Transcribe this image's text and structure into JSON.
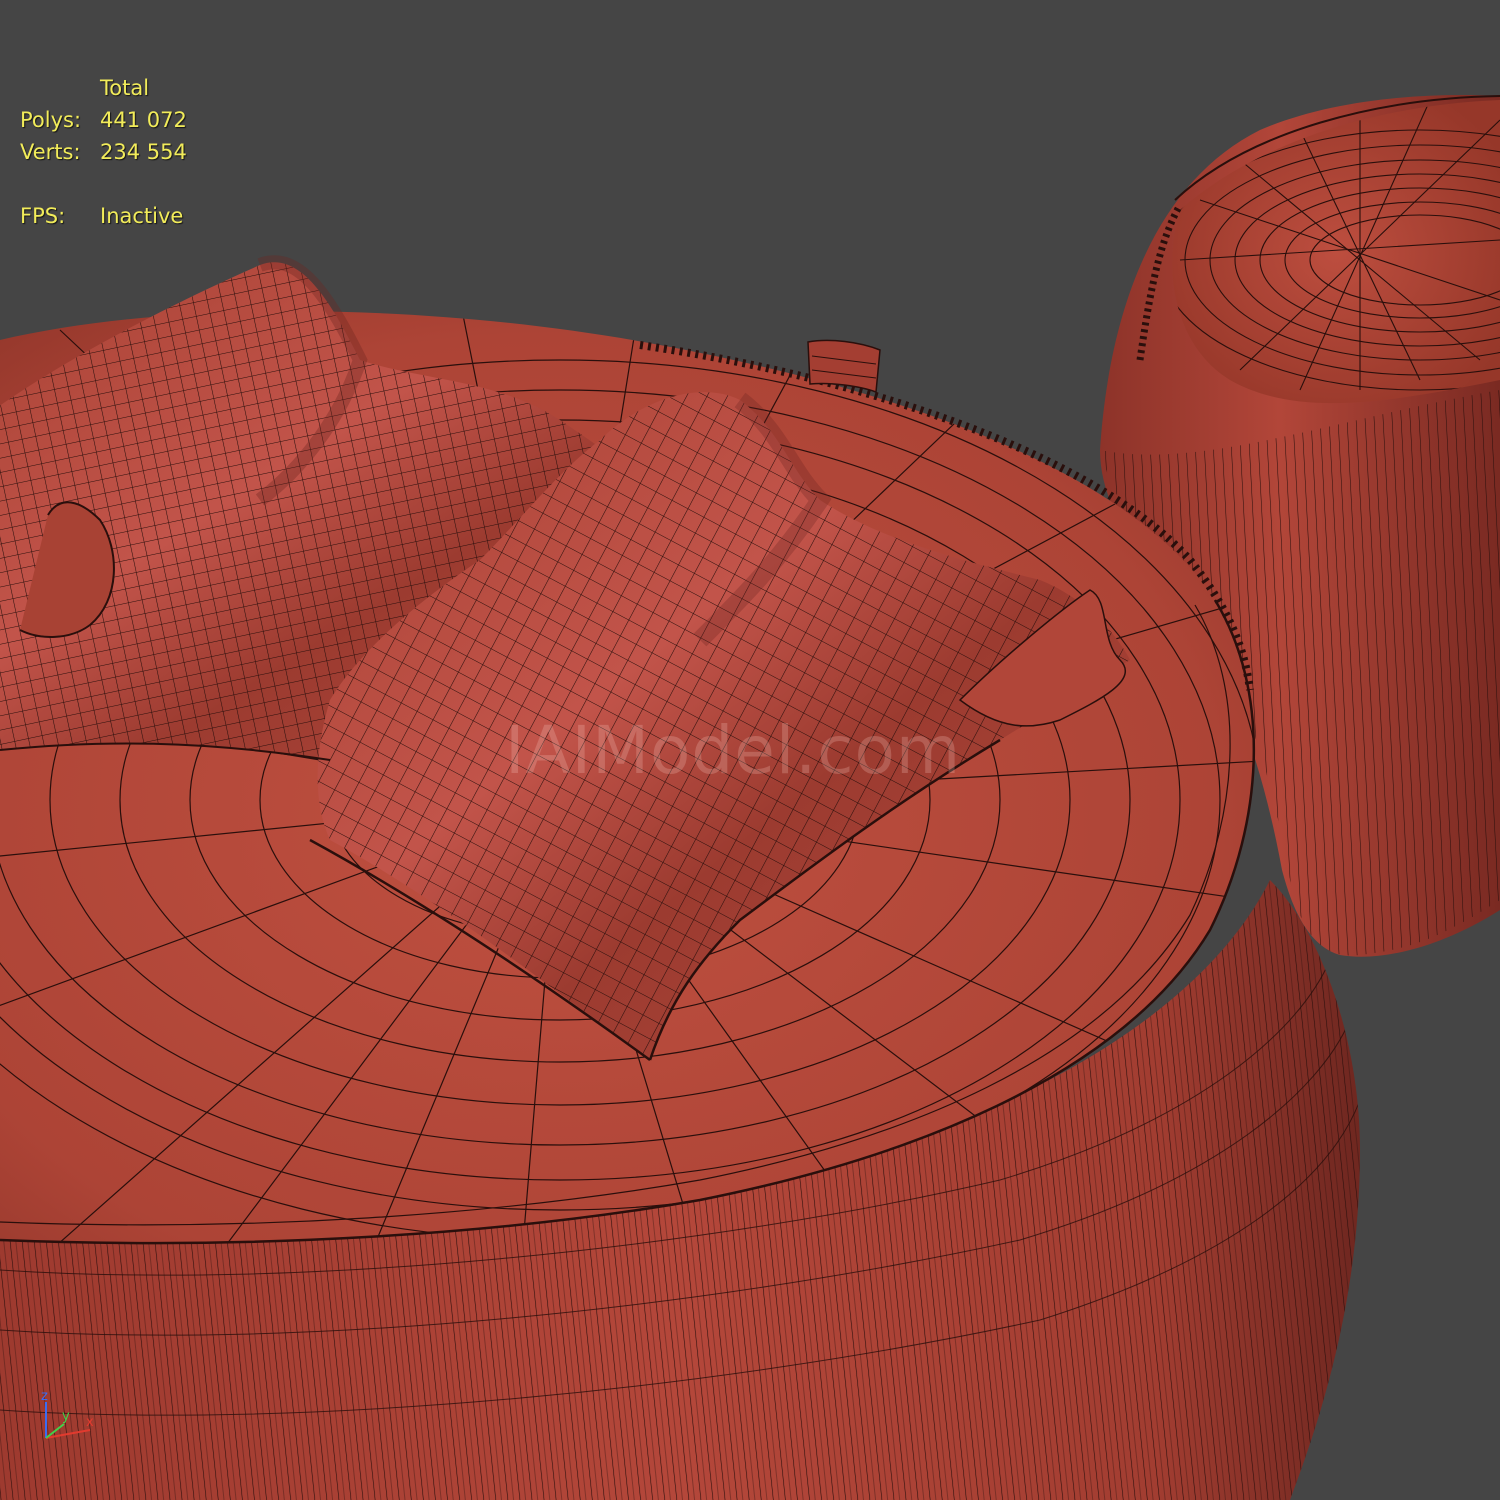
{
  "stats": {
    "header": "Total",
    "polys_label": "Polys:",
    "polys_value": "441 072",
    "verts_label": "Verts:",
    "verts_value": "234 554",
    "fps_label": "FPS:",
    "fps_value": "Inactive"
  },
  "watermark": "IAIModel.com",
  "axis": {
    "x": "x",
    "y": "y",
    "z": "z"
  },
  "colors": {
    "background": "#454545",
    "mesh": "#b2463a",
    "mesh_shadow": "#7e2c24",
    "wire": "#2a0f0c",
    "stats_text": "#f2ec5a"
  }
}
